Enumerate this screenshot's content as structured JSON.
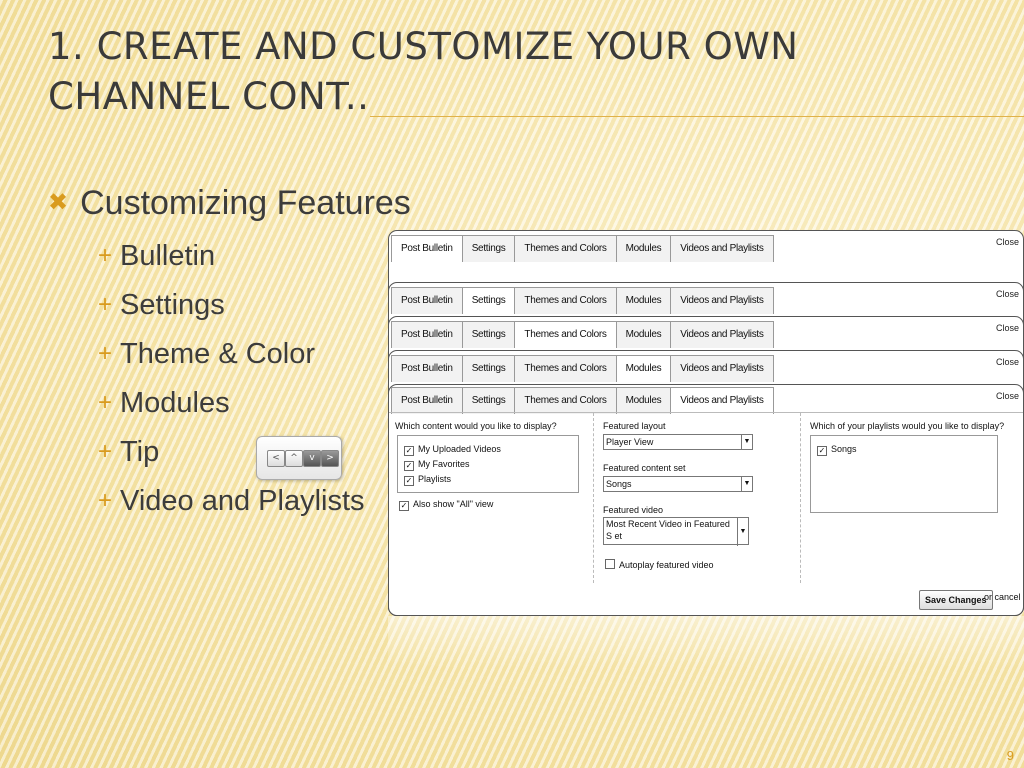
{
  "slide": {
    "title_line1": "1. Create and customize your own",
    "title_line2": "channel cont..",
    "bullet": "Customizing Features",
    "bullet_marker": "✖",
    "sub_marker": "+",
    "sub_items": [
      "Bulletin",
      "Settings",
      "Theme & Color",
      "Modules",
      "Tip",
      "Video and Playlists"
    ],
    "page_number": "9"
  },
  "tip_widget": {
    "buttons": [
      "<",
      "^",
      "v",
      ">"
    ]
  },
  "screenshot": {
    "panels": [
      {
        "tabs": [
          "Post Bulletin",
          "Settings",
          "Themes and Colors",
          "Modules",
          "Videos and Playlists"
        ],
        "active": 0,
        "close": "Close"
      },
      {
        "tabs": [
          "Post Bulletin",
          "Settings",
          "Themes and Colors",
          "Modules",
          "Videos and Playlists"
        ],
        "active": 1,
        "close": "Close"
      },
      {
        "tabs": [
          "Post Bulletin",
          "Settings",
          "Themes and Colors",
          "Modules",
          "Videos and Playlists"
        ],
        "active": 2,
        "close": "Close"
      },
      {
        "tabs": [
          "Post Bulletin",
          "Settings",
          "Themes and Colors",
          "Modules",
          "Videos and Playlists"
        ],
        "active": 3,
        "close": "Close"
      },
      {
        "tabs": [
          "Post Bulletin",
          "Settings",
          "Themes and Colors",
          "Modules",
          "Videos and Playlists"
        ],
        "active": 4,
        "close": "Close"
      }
    ],
    "content_question": "Which content would you like to display?",
    "content_options": [
      {
        "label": "My Uploaded Videos",
        "checked": true
      },
      {
        "label": "My Favorites",
        "checked": true
      },
      {
        "label": "Playlists",
        "checked": true
      }
    ],
    "also_show": "Also show \"All\" view",
    "featured_layout_label": "Featured layout",
    "featured_layout_value": "Player View",
    "featured_content_label": "Featured content set",
    "featured_content_value": "Songs",
    "featured_video_label": "Featured video",
    "featured_video_value": "Most Recent Video in Featured S et",
    "autoplay_label": "Autoplay featured video",
    "playlists_question": "Which of your playlists would you like to display?",
    "playlists": [
      {
        "label": "Songs",
        "checked": true
      }
    ],
    "save_label": "Save Changes",
    "cancel_label": "or cancel"
  },
  "colors": {
    "accent": "#d99b1f",
    "title": "#3a3a3a"
  }
}
